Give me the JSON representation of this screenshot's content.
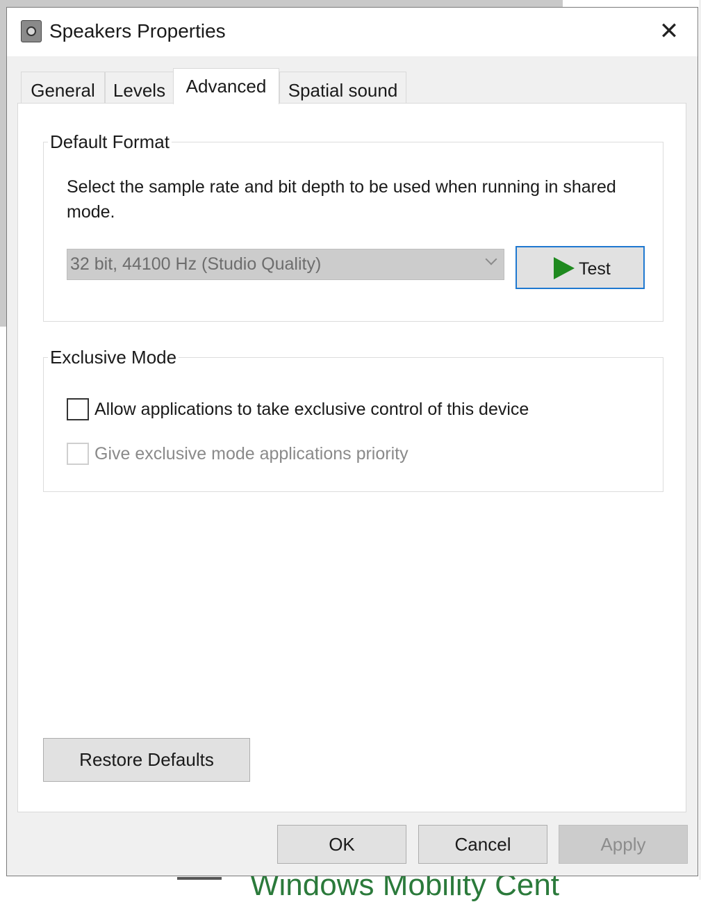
{
  "window": {
    "title": "Speakers Properties",
    "close_glyph": "✕"
  },
  "tabs": [
    {
      "label": "General",
      "active": false
    },
    {
      "label": "Levels",
      "active": false
    },
    {
      "label": "Advanced",
      "active": true
    },
    {
      "label": "Spatial sound",
      "active": false
    }
  ],
  "default_format": {
    "group_label": "Default Format",
    "description": "Select the sample rate and bit depth to be used when running in shared mode.",
    "format_select": {
      "value": "32 bit, 44100 Hz (Studio Quality)",
      "enabled": false
    },
    "test_button": {
      "label": "Test",
      "icon": "play-icon"
    }
  },
  "exclusive_mode": {
    "group_label": "Exclusive Mode",
    "allow_exclusive": {
      "label": "Allow applications to take exclusive control of this device",
      "checked": false,
      "enabled": true
    },
    "give_priority": {
      "label": "Give exclusive mode applications priority",
      "checked": false,
      "enabled": false
    }
  },
  "buttons": {
    "restore_defaults": "Restore Defaults",
    "ok": "OK",
    "cancel": "Cancel",
    "apply": "Apply"
  },
  "background": {
    "bottom_text": "Windows Mobility Cent"
  },
  "colors": {
    "accent": "#1e78d0",
    "play_icon": "#1f8a1f"
  }
}
